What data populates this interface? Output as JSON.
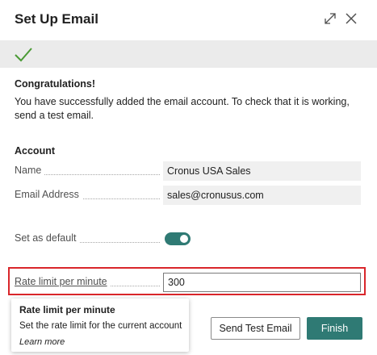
{
  "dialog": {
    "title": "Set Up Email",
    "icons": {
      "expand": "expand-icon",
      "close": "close-icon",
      "status": "checkmark-icon"
    }
  },
  "success": {
    "heading": "Congratulations!",
    "message": "You have successfully added the email account. To check that it is working, send a test email."
  },
  "account": {
    "section_title": "Account",
    "name_label": "Name",
    "name_value": "Cronus USA Sales",
    "email_label": "Email Address",
    "email_value": "sales@cronusus.com",
    "default_label": "Set as default",
    "default_on": true,
    "rate_label": "Rate limit per minute",
    "rate_value": "300"
  },
  "tooltip": {
    "title": "Rate limit per minute",
    "description": "Set the rate limit for the current account",
    "link": "Learn more"
  },
  "buttons": {
    "send_test": "Send Test Email",
    "finish": "Finish"
  },
  "colors": {
    "accent": "#2f7a74",
    "highlight": "#d9262b",
    "banner": "#ebebeb",
    "checkmark": "#4a9a35"
  }
}
